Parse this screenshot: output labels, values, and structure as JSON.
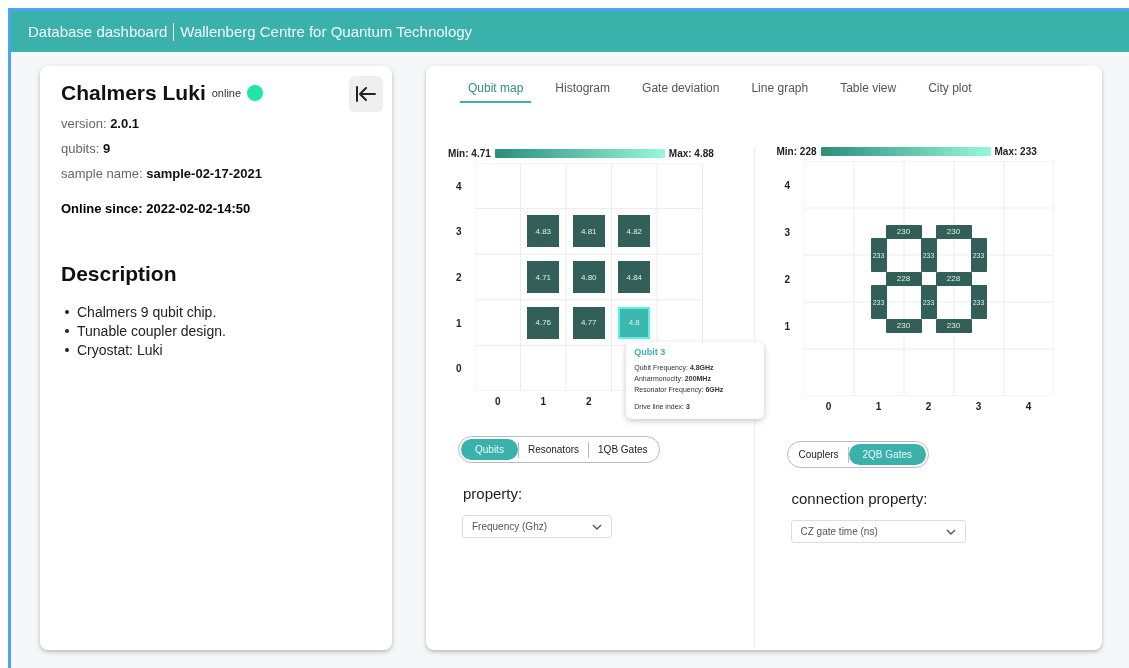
{
  "header": {
    "title": "Database dashboard",
    "subtitle": "Wallenberg Centre for Quantum Technology"
  },
  "device": {
    "name": "Chalmers Luki",
    "status": "online",
    "online": true,
    "fields": [
      {
        "label": "version: ",
        "value": "2.0.1"
      },
      {
        "label": "qubits: ",
        "value": "9"
      },
      {
        "label": "sample name: ",
        "value": "sample-02-17-2021"
      }
    ],
    "online_since": "Online since: 2022-02-02-14:50",
    "description_title": "Description",
    "description": [
      "Chalmers 9 qubit chip.",
      "Tunable coupler design.",
      "Cryostat: Luki"
    ]
  },
  "tabs": [
    {
      "label": "Qubit map",
      "selected": true
    },
    {
      "label": "Histogram",
      "selected": false
    },
    {
      "label": "Gate deviation",
      "selected": false
    },
    {
      "label": "Line graph",
      "selected": false
    },
    {
      "label": "Table view",
      "selected": false
    },
    {
      "label": "City plot",
      "selected": false
    }
  ],
  "plots": [
    {
      "kind": "qubits",
      "min": "Min: 4.71",
      "max": "Max: 4.88",
      "x_ticks": [
        "0",
        "1",
        "2"
      ],
      "y_ticks": [
        "4",
        "3",
        "2",
        "1",
        "0"
      ],
      "rows": [
        {
          "cells": [
            {
              "kind": "empty"
            },
            {
              "kind": "empty"
            },
            {
              "kind": "empty"
            },
            {
              "kind": "empty"
            },
            {
              "kind": "empty"
            }
          ]
        },
        {
          "cells": [
            {
              "kind": "empty"
            },
            {
              "kind": "qubit",
              "value": "4.83",
              "selected": false
            },
            {
              "kind": "qubit",
              "value": "4.81",
              "selected": false
            },
            {
              "kind": "qubit",
              "value": "4.82",
              "selected": false
            },
            {
              "kind": "empty"
            }
          ]
        },
        {
          "cells": [
            {
              "kind": "empty"
            },
            {
              "kind": "qubit",
              "value": "4.71",
              "selected": false
            },
            {
              "kind": "qubit",
              "value": "4.80",
              "selected": false
            },
            {
              "kind": "qubit",
              "value": "4.84",
              "selected": false
            },
            {
              "kind": "empty"
            }
          ]
        },
        {
          "cells": [
            {
              "kind": "empty"
            },
            {
              "kind": "qubit",
              "value": "4.76",
              "selected": false
            },
            {
              "kind": "qubit",
              "value": "4.77",
              "selected": false
            },
            {
              "kind": "qubit",
              "value": "4.8",
              "selected": true,
              "tooltip": {
                "title": "Qubit 3",
                "lines": [
                  "Qubit Frequency: **4.8GHz**",
                  "Anharmonocity: **200MHz**",
                  "Resonator Frequency: **6GHz**"
                ],
                "footer": "Drive line index:  **3**"
              }
            },
            {
              "kind": "empty"
            }
          ]
        },
        {
          "cells": [
            {
              "kind": "empty"
            },
            {
              "kind": "empty"
            },
            {
              "kind": "empty"
            },
            {
              "kind": "empty"
            },
            {
              "kind": "empty"
            }
          ]
        }
      ],
      "toggle": [
        {
          "label": "Qubits",
          "selected": true
        },
        {
          "label": "Resonators",
          "selected": false
        },
        {
          "label": "1QB Gates",
          "selected": false
        }
      ],
      "property_label": "property:",
      "dropdown": "Frequency (Ghz)"
    },
    {
      "kind": "couplers",
      "min": "Min: 228",
      "max": "Max: 233",
      "x_ticks": [
        "0",
        "1",
        "2",
        "3",
        "4"
      ],
      "y_ticks": [
        "4",
        "3",
        "2",
        "1"
      ],
      "rows": [
        {
          "kind": "horizontal",
          "values": [
            "230",
            "230"
          ]
        },
        {
          "kind": "vertical",
          "values": [
            "233",
            "233",
            "233"
          ]
        },
        {
          "kind": "horizontal",
          "values": [
            "228",
            "228"
          ]
        },
        {
          "kind": "vertical",
          "values": [
            "233",
            "233",
            "233"
          ]
        },
        {
          "kind": "horizontal",
          "values": [
            "230",
            "230"
          ]
        }
      ],
      "toggle": [
        {
          "label": "Couplers",
          "selected": false
        },
        {
          "label": "2QB Gates",
          "selected": true
        }
      ],
      "property_label": "connection property:",
      "dropdown": "CZ gate time (ns)"
    }
  ]
}
